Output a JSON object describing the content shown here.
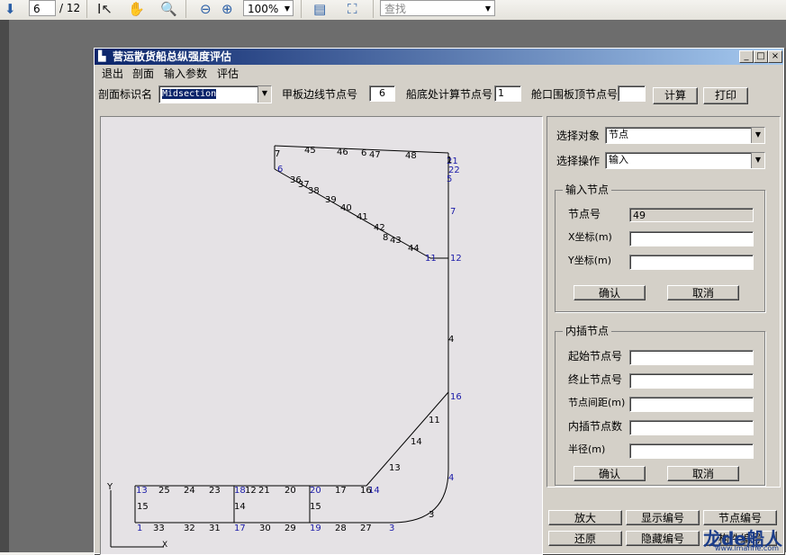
{
  "reader_toolbar": {
    "page_current": "6",
    "page_total": "/ 12",
    "zoom": "100%",
    "search_placeholder": "查找"
  },
  "window": {
    "title": "营运散货船总纵强度评估",
    "controls": {
      "minimize": "_",
      "maximize": "□",
      "close": "×"
    }
  },
  "menu": [
    "退出",
    "剖面",
    "输入参数",
    "评估"
  ],
  "params": {
    "section_label": "剖面标识名",
    "section_value": "Midsection",
    "deck_edge_label": "甲板边线节点号",
    "deck_edge_value": "6",
    "bottom_calc_label": "船底处计算节点号",
    "bottom_calc_value": "1",
    "hatch_top_label": "舱口围板顶节点号",
    "hatch_top_value": "",
    "calc_button": "计算",
    "print_button": "打印"
  },
  "side_panel": {
    "object_label": "选择对象",
    "object_value": "节点",
    "operation_label": "选择操作",
    "operation_value": "输入",
    "input_node": {
      "title": "输入节点",
      "node_no_label": "节点号",
      "node_no_value": "49",
      "x_label": "X坐标(m)",
      "x_value": "",
      "y_label": "Y坐标(m)",
      "y_value": "",
      "ok": "确认",
      "cancel": "取消"
    },
    "interp_node": {
      "title": "内插节点",
      "start_label": "起始节点号",
      "end_label": "终止节点号",
      "spacing_label": "节点间距(m)",
      "count_label": "内插节点数",
      "radius_label": "半径(m)",
      "ok": "确认",
      "cancel": "取消"
    }
  },
  "bottom_buttons": {
    "zoom_in": "放大",
    "show_numbers": "显示编号",
    "node_numbers": "节点编号",
    "restore": "还原",
    "hide_numbers": "隐藏编号",
    "element_numbers": "构件编号"
  },
  "watermark": {
    "main": "龙de船人",
    "sub": "www.lmanne.com"
  },
  "axes": {
    "y": "Y",
    "x": "X"
  },
  "colors": {
    "node": "#1a1aa8",
    "element": "#000000",
    "titlebar": "#0a246a"
  },
  "node_labels": [
    "1",
    "3",
    "4",
    "5",
    "6",
    "7",
    "8",
    "11",
    "12",
    "13",
    "14",
    "16",
    "17",
    "18",
    "19",
    "20",
    "21",
    "22"
  ],
  "element_labels": [
    "1",
    "2",
    "3",
    "4",
    "5",
    "6",
    "7",
    "8",
    "10",
    "11",
    "12",
    "13",
    "14",
    "15",
    "16",
    "17",
    "20",
    "21",
    "23",
    "24",
    "25",
    "26",
    "27",
    "28",
    "29",
    "30",
    "31",
    "32",
    "33",
    "34",
    "35",
    "36",
    "37",
    "38",
    "39",
    "40",
    "41",
    "42",
    "43",
    "44",
    "45",
    "46",
    "47",
    "48"
  ]
}
